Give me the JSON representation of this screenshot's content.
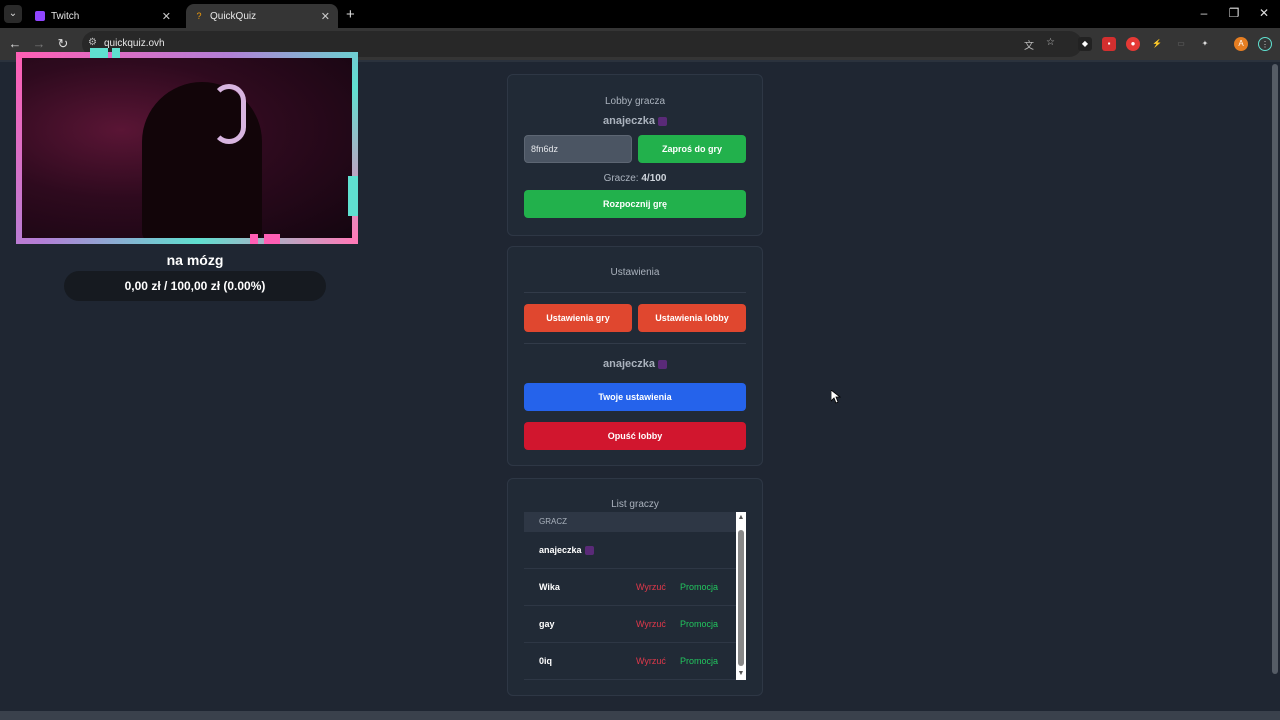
{
  "browser": {
    "tabs": [
      {
        "title": "Twitch",
        "active": false
      },
      {
        "title": "QuickQuiz",
        "active": true
      }
    ],
    "url": "quickquiz.ovh"
  },
  "stream": {
    "title": "na mózg",
    "goal": "0,00 zł / 100,00 zł (0.00%)"
  },
  "lobby": {
    "title": "Lobby gracza",
    "owner": "anajeczka",
    "code": "8fn6dz",
    "invite_label": "Zaproś do gry",
    "players_label": "Gracze:",
    "players_count": "4/100",
    "start_label": "Rozpocznij grę"
  },
  "settings": {
    "title": "Ustawienia",
    "game_settings_label": "Ustawienia gry",
    "lobby_settings_label": "Ustawienia lobby",
    "username": "anajeczka",
    "your_settings_label": "Twoje ustawienia",
    "leave_label": "Opuść lobby"
  },
  "player_list": {
    "title": "List graczy",
    "header": "GRACZ",
    "kick_label": "Wyrzuć",
    "promote_label": "Promocja",
    "players": [
      {
        "name": "anajeczka"
      },
      {
        "name": "Wika"
      },
      {
        "name": "gay"
      },
      {
        "name": "0iq"
      }
    ]
  },
  "colors": {
    "page_bg": "#1f2632",
    "card_bg": "#212a36",
    "green": "#22b14c",
    "red": "#e0472f",
    "blue": "#2563eb",
    "crimson": "#d1162e"
  }
}
